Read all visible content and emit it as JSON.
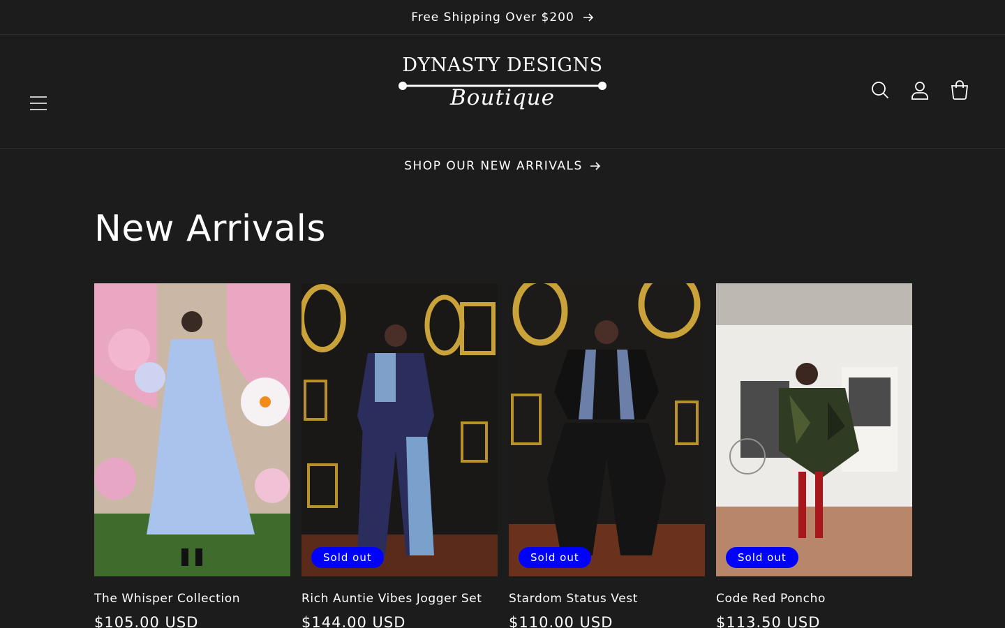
{
  "announcement": {
    "text": "Free Shipping Over $200"
  },
  "header": {
    "logo_top": "DYNASTY DESIGNS",
    "logo_bottom": "Boutique"
  },
  "promo": {
    "text": "SHOP OUR NEW ARRIVALS"
  },
  "collection": {
    "title": "New Arrivals",
    "products": [
      {
        "title": "The Whisper Collection",
        "price": "$105.00 USD",
        "badge": ""
      },
      {
        "title": "Rich Auntie Vibes Jogger Set",
        "price": "$144.00 USD",
        "badge": "Sold out"
      },
      {
        "title": "Stardom Status Vest",
        "price": "$110.00 USD",
        "badge": "Sold out"
      },
      {
        "title": "Code Red Poncho",
        "price": "$113.50 USD",
        "badge": "Sold out"
      }
    ]
  },
  "colors": {
    "background": "#1c1c1c",
    "badge": "#0000ff",
    "text": "#ffffff"
  },
  "icons": [
    "arrow-right-icon",
    "menu-icon",
    "search-icon",
    "account-icon",
    "cart-icon"
  ]
}
